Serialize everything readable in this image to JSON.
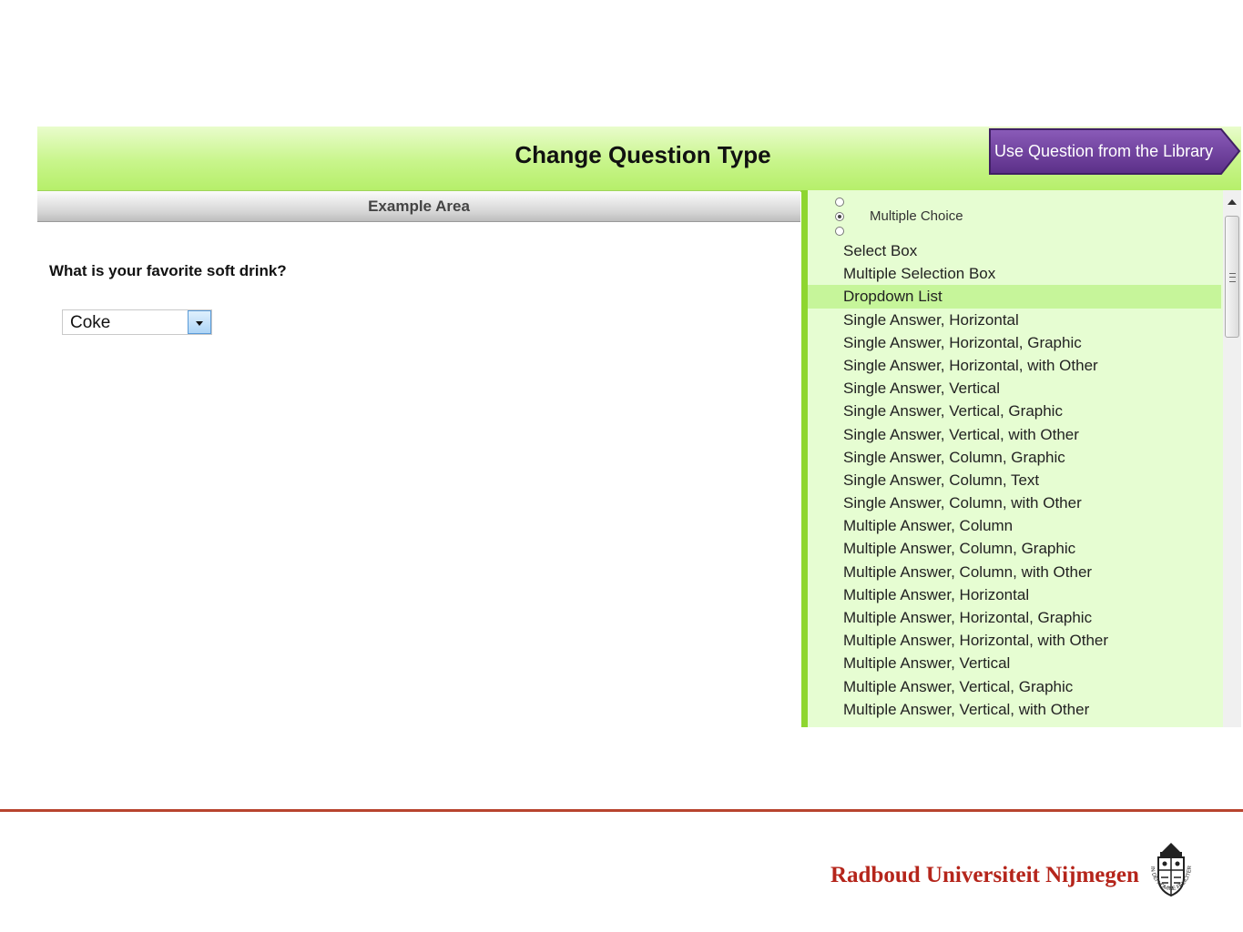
{
  "header": {
    "title": "Change Question Type",
    "library_button": "Use Question from the Library",
    "accent_color": "#6b3d98"
  },
  "example_area": {
    "title": "Example Area",
    "question": "What is your favorite soft drink?",
    "dropdown_value": "Coke"
  },
  "question_types": {
    "group_label": "Multiple Choice",
    "items": [
      "Select Box",
      "Multiple Selection Box",
      "Dropdown List",
      "Single Answer, Horizontal",
      "Single Answer, Horizontal, Graphic",
      "Single Answer, Horizontal, with Other",
      "Single Answer, Vertical",
      "Single Answer, Vertical, Graphic",
      "Single Answer, Vertical, with Other",
      "Single Answer, Column, Graphic",
      "Single Answer, Column, Text",
      "Single Answer, Column, with Other",
      "Multiple Answer, Column",
      "Multiple Answer, Column, Graphic",
      "Multiple Answer, Column, with Other",
      "Multiple Answer, Horizontal",
      "Multiple Answer, Horizontal, Graphic",
      "Multiple Answer, Horizontal, with Other",
      "Multiple Answer, Vertical",
      "Multiple Answer, Vertical, Graphic",
      "Multiple Answer, Vertical, with Other"
    ],
    "selected_item": "Dropdown List"
  },
  "footer": {
    "brand": "Radboud Universiteit Nijmegen",
    "seal_motto": "IN DEI NOMINE FELICITER",
    "brand_color": "#b5251b"
  }
}
